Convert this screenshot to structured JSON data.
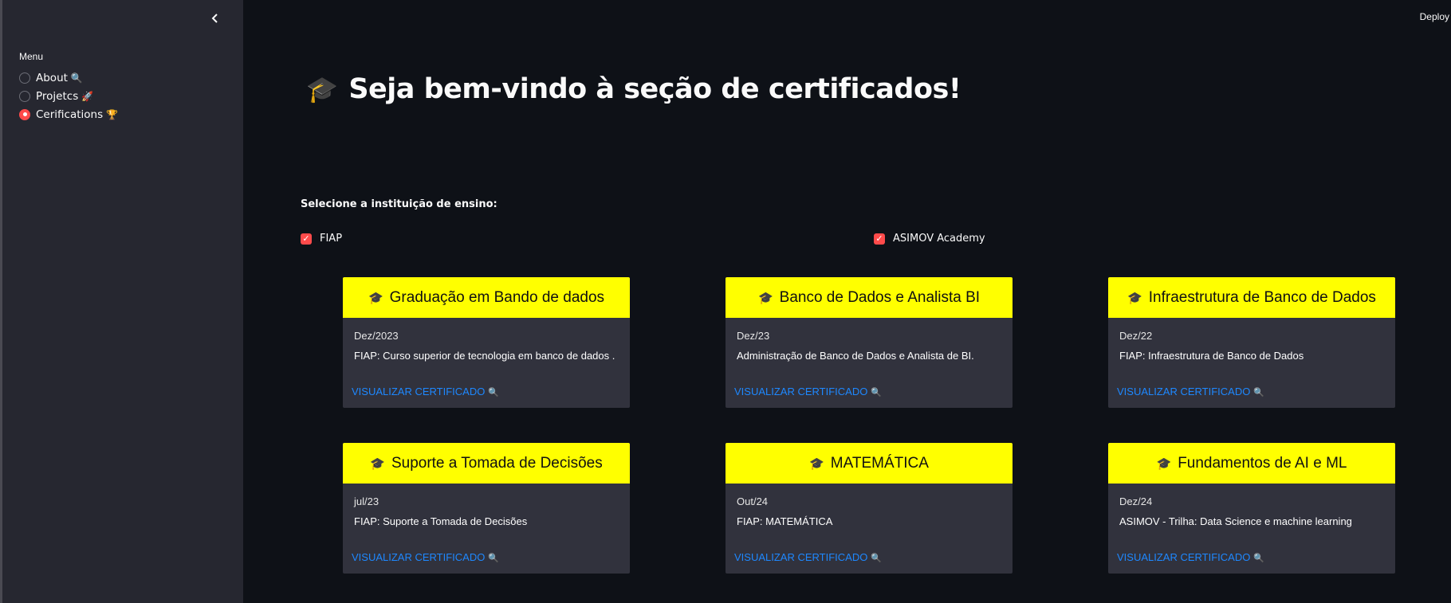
{
  "sidebar": {
    "collapse_icon": "chevron-left-icon",
    "menu_title": "Menu",
    "items": [
      {
        "label": "About",
        "emoji": "🔍",
        "selected": false
      },
      {
        "label": "Projetcs",
        "emoji": "🚀",
        "selected": false
      },
      {
        "label": "Cerifications",
        "emoji": "🏆",
        "selected": true
      }
    ]
  },
  "header": {
    "deploy_label": "Deploy"
  },
  "main": {
    "title_icon": "🎓",
    "title": "Seja bem-vindo à seção de certificados!",
    "institution_label": "Selecione a instituição de ensino:",
    "checkboxes": [
      {
        "label": "FIAP",
        "checked": true
      },
      {
        "label": "ASIMOV Academy",
        "checked": true
      }
    ],
    "cards": [
      {
        "icon": "🎓",
        "title": "Graduação em Bando de dados",
        "date": "Dez/2023",
        "description": "FIAP: Curso superior de tecnologia em banco de dados .",
        "link": "VISUALIZAR CERTIFICADO",
        "link_icon": "🔍"
      },
      {
        "icon": "🎓",
        "title": "Banco de Dados e Analista BI",
        "date": "Dez/23",
        "description": "Administração de Banco de Dados e Analista de BI.",
        "link": "VISUALIZAR CERTIFICADO",
        "link_icon": "🔍"
      },
      {
        "icon": "🎓",
        "title": "Infraestrutura de Banco de Dados",
        "date": "Dez/22",
        "description": "FIAP: Infraestrutura de Banco de Dados",
        "link": "VISUALIZAR CERTIFICADO",
        "link_icon": "🔍"
      },
      {
        "icon": "🎓",
        "title": "Suporte a Tomada de Decisões",
        "date": "jul/23",
        "description": "FIAP: Suporte a Tomada de Decisões",
        "link": "VISUALIZAR CERTIFICADO",
        "link_icon": "🔍"
      },
      {
        "icon": "🎓",
        "title": "MATEMÁTICA",
        "date": "Out/24",
        "description": "FIAP: MATEMÁTICA",
        "link": "VISUALIZAR CERTIFICADO",
        "link_icon": "🔍"
      },
      {
        "icon": "🎓",
        "title": "Fundamentos de AI e ML",
        "date": "Dez/24",
        "description": "ASIMOV - Trilha: Data Science e machine learning",
        "link": "VISUALIZAR CERTIFICADO",
        "link_icon": "🔍"
      }
    ]
  },
  "colors": {
    "background": "#0e1117",
    "sidebar": "#262730",
    "card_header": "#ffff00",
    "card_body": "#31323d",
    "accent": "#ff4b4b",
    "link": "#1e88ff"
  }
}
